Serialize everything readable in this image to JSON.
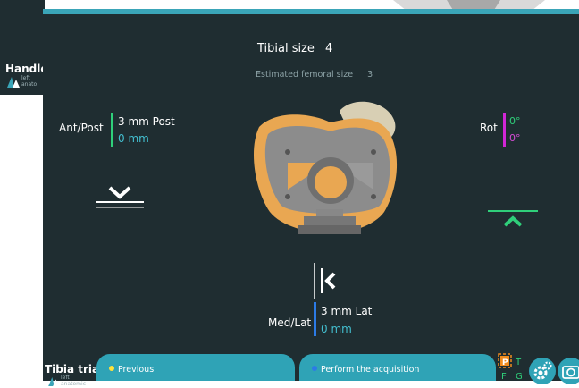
{
  "background_window": {
    "title": "Handle",
    "logo_text": [
      "left",
      "anato"
    ]
  },
  "header": {
    "tibial_size_label": "Tibial size",
    "tibial_size_value": "4",
    "est_femoral_label": "Estimated femoral size",
    "est_femoral_value": "3"
  },
  "ant_post": {
    "label": "Ant/Post",
    "value_primary": "3 mm Post",
    "value_secondary": "0 mm",
    "accent": "#2fcf7a"
  },
  "rotation": {
    "label": "Rot",
    "value_primary": "0°",
    "value_secondary": "0°",
    "accent": "#d126d6"
  },
  "med_lat": {
    "label": "Med/Lat",
    "value_primary": "3 mm Lat",
    "value_secondary": "0 mm",
    "accent": "#2c7be6"
  },
  "bottom_bar": {
    "title": "Tibia trial",
    "logo_text": [
      "left",
      "anatomic"
    ],
    "previous_label": "Previous",
    "previous_dot_color": "#ffe23a",
    "acquisition_label": "Perform the acquisition",
    "acquisition_dot_color": "#2c7be6",
    "tracker_letters": {
      "p": "P",
      "t": "T",
      "f": "F",
      "g": "G"
    },
    "icons": [
      "tracker-status-icon",
      "settings-gear-icon",
      "camera-icon"
    ]
  },
  "colors": {
    "panel_bg": "#1f2d31",
    "top_border": "#3aa5b8",
    "button": "#2fa3b6",
    "muted_text": "#8da3a7",
    "value_cyan": "#43bfd0"
  }
}
